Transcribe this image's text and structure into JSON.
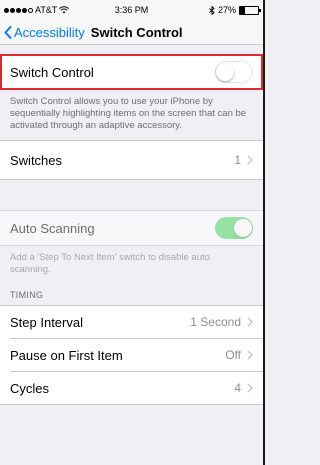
{
  "status_bar": {
    "carrier": "AT&T",
    "time": "3:36 PM",
    "battery": "27%"
  },
  "nav": {
    "back_label": "Accessibility",
    "title": "Switch Control"
  },
  "switch_control": {
    "label": "Switch Control",
    "enabled": false,
    "description": "Switch Control allows you to use your iPhone by sequentially highlighting items on the screen that can be activated through an adaptive accessory."
  },
  "switches": {
    "label": "Switches",
    "value": "1"
  },
  "auto_scanning": {
    "label": "Auto Scanning",
    "enabled": true,
    "description": "Add a 'Step To Next Item' switch to disable auto scanning."
  },
  "timing": {
    "header": "TIMING",
    "rows": [
      {
        "label": "Step Interval",
        "value": "1 Second"
      },
      {
        "label": "Pause on First Item",
        "value": "Off"
      },
      {
        "label": "Cycles",
        "value": "4"
      }
    ]
  },
  "colors": {
    "accent": "#007aff",
    "toggle_on": "#4cd964",
    "highlight": "#e0282e"
  }
}
